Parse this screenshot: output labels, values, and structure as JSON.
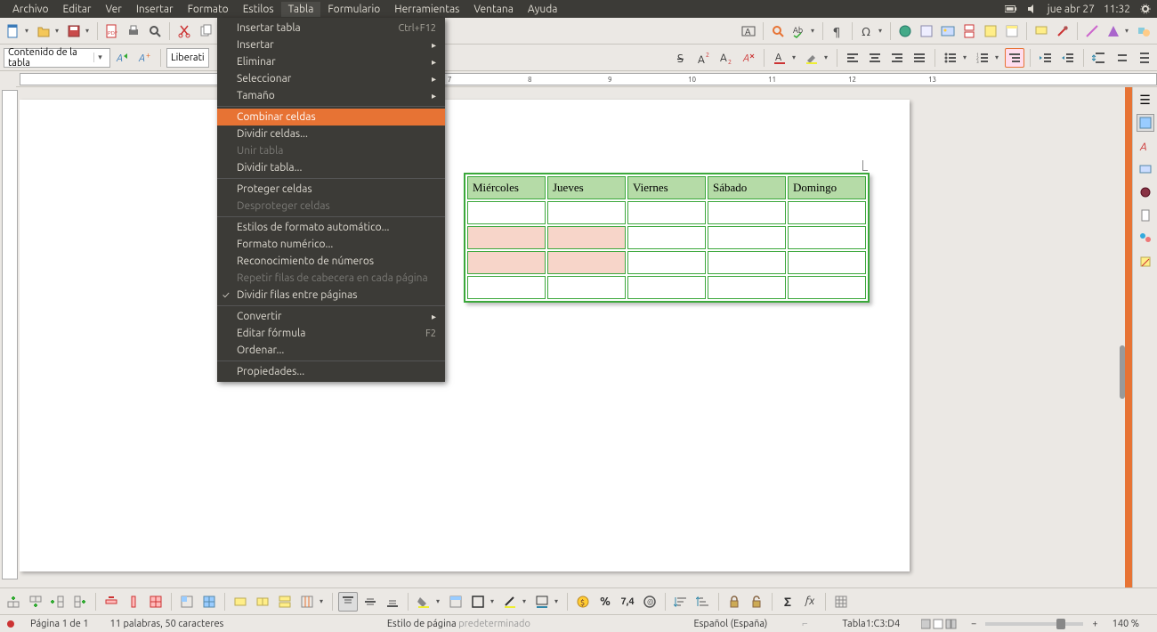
{
  "system": {
    "date": "jue abr 27",
    "time": "11:32"
  },
  "menubar": {
    "items": [
      "Archivo",
      "Editar",
      "Ver",
      "Insertar",
      "Formato",
      "Estilos",
      "Tabla",
      "Formulario",
      "Herramientas",
      "Ventana",
      "Ayuda"
    ]
  },
  "toolbar2": {
    "paragraph_style": "Contenido de la tabla",
    "font_name": "Liberati"
  },
  "dropdown": {
    "items": [
      {
        "label": "Insertar tabla",
        "shortcut": "Ctrl+F12"
      },
      {
        "label": "Insertar",
        "submenu": true
      },
      {
        "label": "Eliminar",
        "submenu": true
      },
      {
        "label": "Seleccionar",
        "submenu": true
      },
      {
        "label": "Tamaño",
        "submenu": true
      },
      {
        "sep": true
      },
      {
        "label": "Combinar celdas",
        "highlighted": true
      },
      {
        "label": "Dividir celdas..."
      },
      {
        "label": "Unir tabla",
        "disabled": true
      },
      {
        "label": "Dividir tabla..."
      },
      {
        "sep": true
      },
      {
        "label": "Proteger celdas"
      },
      {
        "label": "Desproteger celdas",
        "disabled": true
      },
      {
        "sep": true
      },
      {
        "label": "Estilos de formato automático..."
      },
      {
        "label": "Formato numérico..."
      },
      {
        "label": "Reconocimiento de números"
      },
      {
        "label": "Repetir filas de cabecera en cada página",
        "disabled": true
      },
      {
        "label": "Dividir filas entre páginas",
        "checked": true
      },
      {
        "sep": true
      },
      {
        "label": "Convertir",
        "submenu": true
      },
      {
        "label": "Editar fórmula",
        "shortcut": "F2"
      },
      {
        "label": "Ordenar..."
      },
      {
        "sep": true
      },
      {
        "label": "Propiedades..."
      }
    ]
  },
  "table": {
    "headers": [
      "Miércoles",
      "Jueves",
      "Viernes",
      "Sábado",
      "Domingo"
    ],
    "rows": 4,
    "highlight_cells": [
      [
        1,
        0
      ],
      [
        1,
        1
      ],
      [
        2,
        0
      ],
      [
        2,
        1
      ]
    ]
  },
  "ruler": {
    "marks": [
      "7",
      "8",
      "9",
      "10",
      "11",
      "12",
      "13"
    ]
  },
  "status": {
    "page": "Página 1 de 1",
    "words": "11 palabras, 50 caracteres",
    "page_style_label": "Estilo de página ",
    "page_style_value": "predeterminado",
    "language": "Español (España)",
    "table_ref": "Tabla1:C3:D4",
    "zoom": "140 %"
  }
}
